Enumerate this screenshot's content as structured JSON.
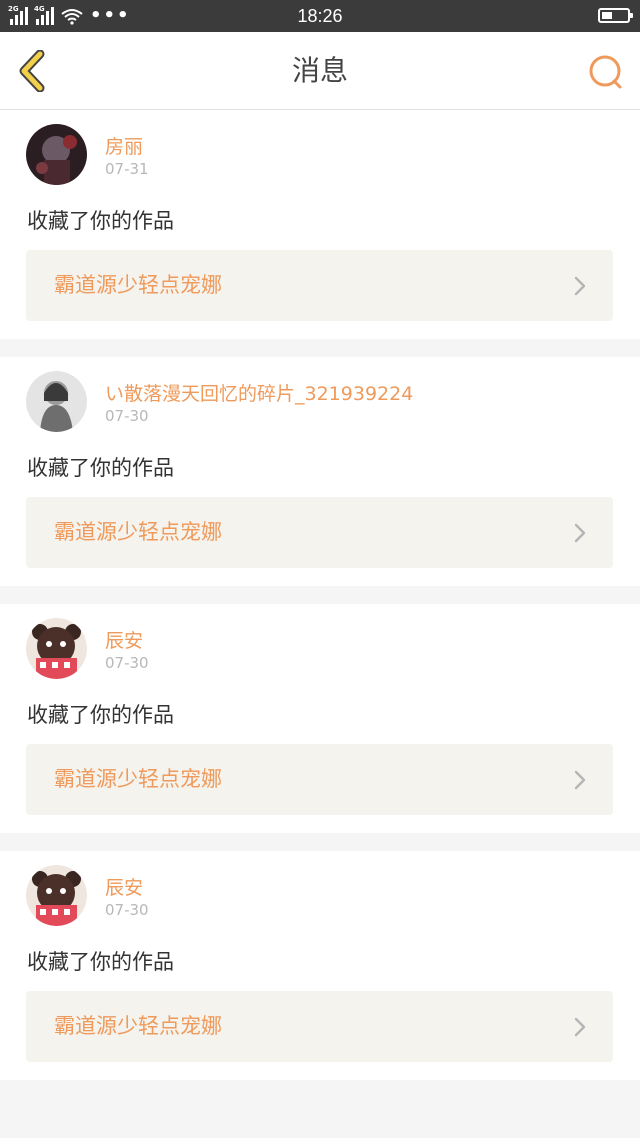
{
  "status_bar": {
    "network_1": "2G",
    "network_2": "4G",
    "more": "•••",
    "time": "18:26",
    "battery_level": 0.4
  },
  "nav": {
    "title": "消息",
    "back_icon": "back-chevron-icon",
    "search_icon": "search-icon",
    "accent_color": "#ef9a5b"
  },
  "messages": [
    {
      "username": "房丽",
      "date": "07-31",
      "action": "收藏了你的作品",
      "work_title": "霸道源少轻点宠娜"
    },
    {
      "username": "い散落漫天回忆的碎片_321939224",
      "date": "07-30",
      "action": "收藏了你的作品",
      "work_title": "霸道源少轻点宠娜"
    },
    {
      "username": "辰安",
      "date": "07-30",
      "action": "收藏了你的作品",
      "work_title": "霸道源少轻点宠娜"
    },
    {
      "username": "辰安",
      "date": "07-30",
      "action": "收藏了你的作品",
      "work_title": "霸道源少轻点宠娜"
    }
  ]
}
